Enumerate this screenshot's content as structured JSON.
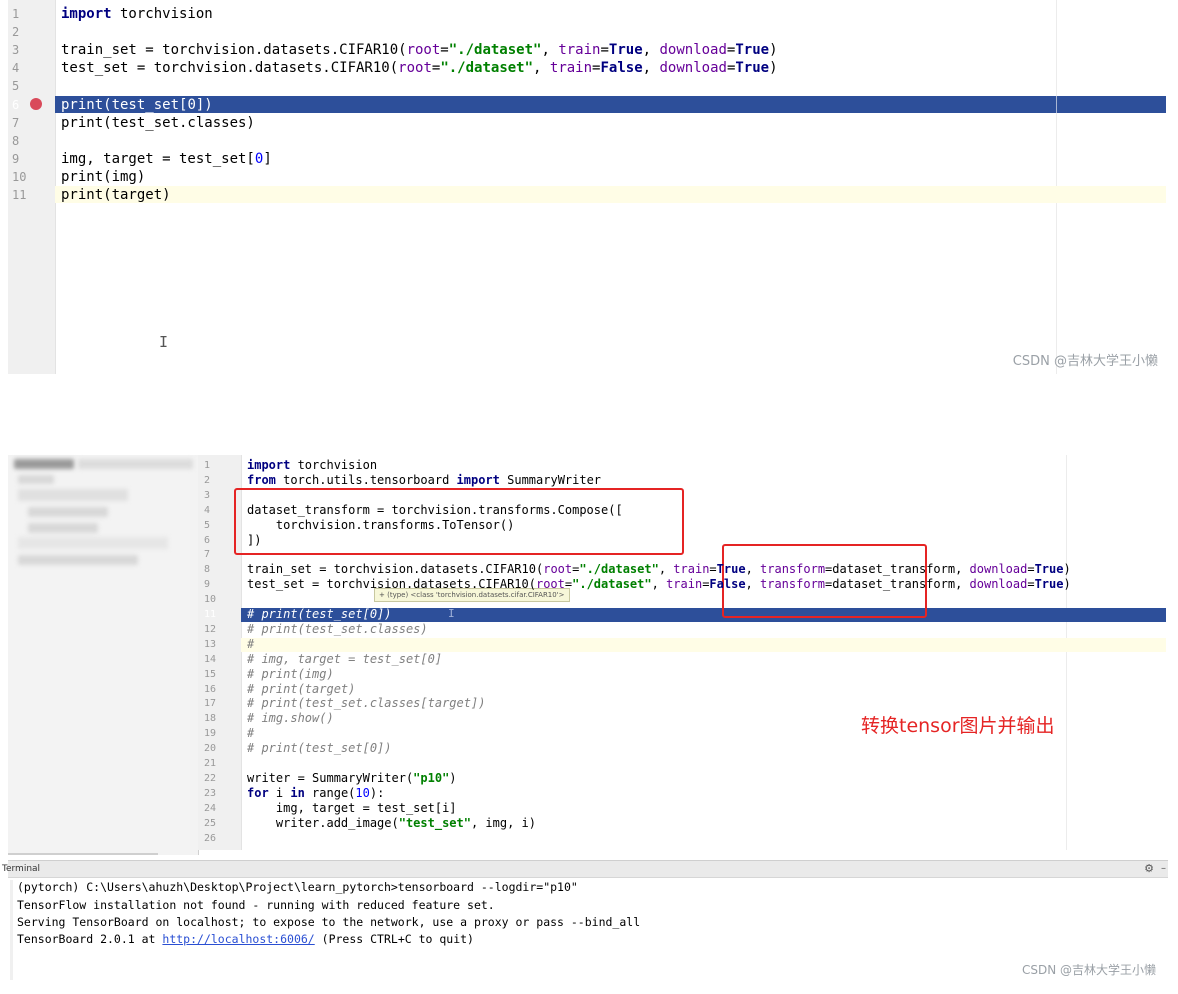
{
  "editor1": {
    "line_numbers": [
      "1",
      "2",
      "3",
      "4",
      "5",
      "6",
      "7",
      "8",
      "9",
      "10",
      "11"
    ],
    "lines": [
      [
        {
          "t": "import",
          "c": "kw"
        },
        {
          "t": " torchvision"
        }
      ],
      [],
      [
        {
          "t": "train_set = torchvision.datasets.CIFAR10("
        },
        {
          "t": "root",
          "c": "param"
        },
        {
          "t": "="
        },
        {
          "t": "\"./dataset\"",
          "c": "str"
        },
        {
          "t": ", "
        },
        {
          "t": "train",
          "c": "param"
        },
        {
          "t": "="
        },
        {
          "t": "True",
          "c": "kw"
        },
        {
          "t": ", "
        },
        {
          "t": "download",
          "c": "param"
        },
        {
          "t": "="
        },
        {
          "t": "True",
          "c": "kw"
        },
        {
          "t": ")"
        }
      ],
      [
        {
          "t": "test_set = torchvision.datasets.CIFAR10("
        },
        {
          "t": "root",
          "c": "param"
        },
        {
          "t": "="
        },
        {
          "t": "\"./dataset\"",
          "c": "str"
        },
        {
          "t": ", "
        },
        {
          "t": "train",
          "c": "param"
        },
        {
          "t": "="
        },
        {
          "t": "False",
          "c": "kw"
        },
        {
          "t": ", "
        },
        {
          "t": "download",
          "c": "param"
        },
        {
          "t": "="
        },
        {
          "t": "True",
          "c": "kw"
        },
        {
          "t": ")"
        }
      ],
      [],
      [
        {
          "t": "print(test_set["
        },
        {
          "t": "0",
          "c": "num"
        },
        {
          "t": "])"
        }
      ],
      [
        {
          "t": "print(test_set.classes)"
        }
      ],
      [],
      [
        {
          "t": "img, target = test_set["
        },
        {
          "t": "0",
          "c": "num"
        },
        {
          "t": "]"
        }
      ],
      [
        {
          "t": "print(img)"
        }
      ],
      [
        {
          "t": "print(target)"
        }
      ]
    ],
    "breakpoint_line": 6,
    "watermark": "CSDN @吉林大学王小懒"
  },
  "editor2": {
    "line_numbers": [
      "1",
      "2",
      "3",
      "4",
      "5",
      "6",
      "7",
      "8",
      "9",
      "10",
      "11",
      "12",
      "13",
      "14",
      "15",
      "16",
      "17",
      "18",
      "19",
      "20",
      "21",
      "22",
      "23",
      "24",
      "25",
      "26"
    ],
    "lines": [
      [
        {
          "t": "import",
          "c": "kw"
        },
        {
          "t": " torchvision"
        }
      ],
      [
        {
          "t": "from",
          "c": "kw"
        },
        {
          "t": " torch.utils.tensorboard "
        },
        {
          "t": "import",
          "c": "kw"
        },
        {
          "t": " SummaryWriter"
        }
      ],
      [],
      [
        {
          "t": "dataset_transform = torchvision.transforms.Compose(["
        }
      ],
      [
        {
          "t": "    torchvision.transforms.ToTensor()"
        }
      ],
      [
        {
          "t": "])"
        }
      ],
      [],
      [
        {
          "t": "train_set = torchvision.datasets.CIFAR10("
        },
        {
          "t": "root",
          "c": "param"
        },
        {
          "t": "="
        },
        {
          "t": "\"./dataset\"",
          "c": "str"
        },
        {
          "t": ", "
        },
        {
          "t": "train",
          "c": "param"
        },
        {
          "t": "="
        },
        {
          "t": "True",
          "c": "kw"
        },
        {
          "t": ", "
        },
        {
          "t": "transform",
          "c": "param"
        },
        {
          "t": "=dataset_transform, "
        },
        {
          "t": "download",
          "c": "param"
        },
        {
          "t": "="
        },
        {
          "t": "True",
          "c": "kw"
        },
        {
          "t": ")"
        }
      ],
      [
        {
          "t": "test_set = torchvision.datasets.CIFAR10("
        },
        {
          "t": "root",
          "c": "param"
        },
        {
          "t": "="
        },
        {
          "t": "\"./dataset\"",
          "c": "str"
        },
        {
          "t": ", "
        },
        {
          "t": "train",
          "c": "param"
        },
        {
          "t": "="
        },
        {
          "t": "False",
          "c": "kw"
        },
        {
          "t": ", "
        },
        {
          "t": "transform",
          "c": "param"
        },
        {
          "t": "=dataset_transform, "
        },
        {
          "t": "download",
          "c": "param"
        },
        {
          "t": "="
        },
        {
          "t": "True",
          "c": "kw"
        },
        {
          "t": ")"
        }
      ],
      [],
      [
        {
          "t": "# print(test_set[0])",
          "c": "cmt"
        }
      ],
      [
        {
          "t": "# print(test_set.classes)",
          "c": "cmt"
        }
      ],
      [
        {
          "t": "#",
          "c": "cmt"
        }
      ],
      [
        {
          "t": "# img, target = test_set[0]",
          "c": "cmt"
        }
      ],
      [
        {
          "t": "# print(img)",
          "c": "cmt"
        }
      ],
      [
        {
          "t": "# print(target)",
          "c": "cmt"
        }
      ],
      [
        {
          "t": "# print(test_set.classes[target])",
          "c": "cmt"
        }
      ],
      [
        {
          "t": "# img.show()",
          "c": "cmt"
        }
      ],
      [
        {
          "t": "#",
          "c": "cmt"
        }
      ],
      [
        {
          "t": "# print(test_set[0])",
          "c": "cmt"
        }
      ],
      [],
      [
        {
          "t": "writer = SummaryWriter("
        },
        {
          "t": "\"p10\"",
          "c": "str"
        },
        {
          "t": ")"
        }
      ],
      [
        {
          "t": "for",
          "c": "kw"
        },
        {
          "t": " i "
        },
        {
          "t": "in",
          "c": "kw"
        },
        {
          "t": " range("
        },
        {
          "t": "10",
          "c": "num"
        },
        {
          "t": "):"
        }
      ],
      [
        {
          "t": "    img, target = test_set[i]"
        }
      ],
      [
        {
          "t": "    writer.add_image("
        },
        {
          "t": "\"test_set\"",
          "c": "str"
        },
        {
          "t": ", img, i)"
        }
      ],
      []
    ],
    "tooltip": "(type) <class 'torchvision.datasets.cifar.CIFAR10'>",
    "annotation": "转换tensor图片并输出"
  },
  "terminal": {
    "title": "Terminal",
    "lines": [
      "(pytorch) C:\\Users\\ahuzh\\Desktop\\Project\\learn_pytorch>tensorboard --logdir=\"p10\"",
      "TensorFlow installation not found - running with reduced feature set.",
      "Serving TensorBoard on localhost; to expose to the network, use a proxy or pass --bind_all"
    ],
    "last_line_prefix": "TensorBoard 2.0.1 at ",
    "last_line_link": "http://localhost:6006/",
    "last_line_suffix": " (Press CTRL+C to quit)",
    "settings_icon": "gear-icon"
  },
  "watermark2": "CSDN @吉林大学王小懒",
  "colors": {
    "selected_line": "#2d4f9a",
    "caret_line": "#fffde6",
    "annotation_red": "#e52424",
    "breakpoint": "#d94a5a"
  }
}
